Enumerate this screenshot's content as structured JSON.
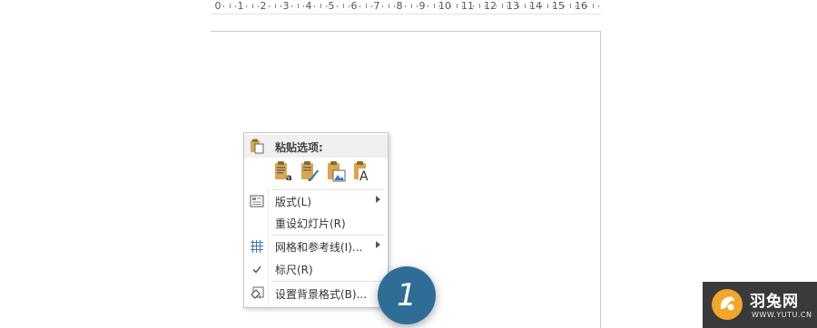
{
  "ruler": {
    "numbers": [
      "0",
      "1",
      "2",
      "3",
      "4",
      "5",
      "6",
      "7",
      "8",
      "9",
      "10",
      "11",
      "12",
      "13",
      "14",
      "15",
      "16"
    ]
  },
  "context_menu": {
    "paste_header": "粘贴选项:",
    "paste_options": [
      {
        "icon": "paste-use-destination-theme-icon"
      },
      {
        "icon": "paste-keep-source-formatting-icon"
      },
      {
        "icon": "paste-picture-icon"
      },
      {
        "icon": "paste-keep-text-only-icon"
      }
    ],
    "items": [
      {
        "label": "版式(L)",
        "icon": "layout-icon",
        "submenu": true
      },
      {
        "label": "重设幻灯片(R)",
        "icon": "",
        "submenu": false
      },
      {
        "label": "网格和参考线(I)...",
        "icon": "grid-icon",
        "submenu": true
      },
      {
        "label": "标尺(R)",
        "icon": "checkmark-icon",
        "submenu": false,
        "checked": true
      },
      {
        "label": "设置背景格式(B)...",
        "icon": "format-background-icon",
        "submenu": false
      }
    ]
  },
  "step_badge": {
    "number": "1",
    "color": "#2f6d97"
  },
  "watermark": {
    "title": "羽兔网",
    "url": "WWW.YUTU.CN",
    "accent": "#f2a62b"
  }
}
